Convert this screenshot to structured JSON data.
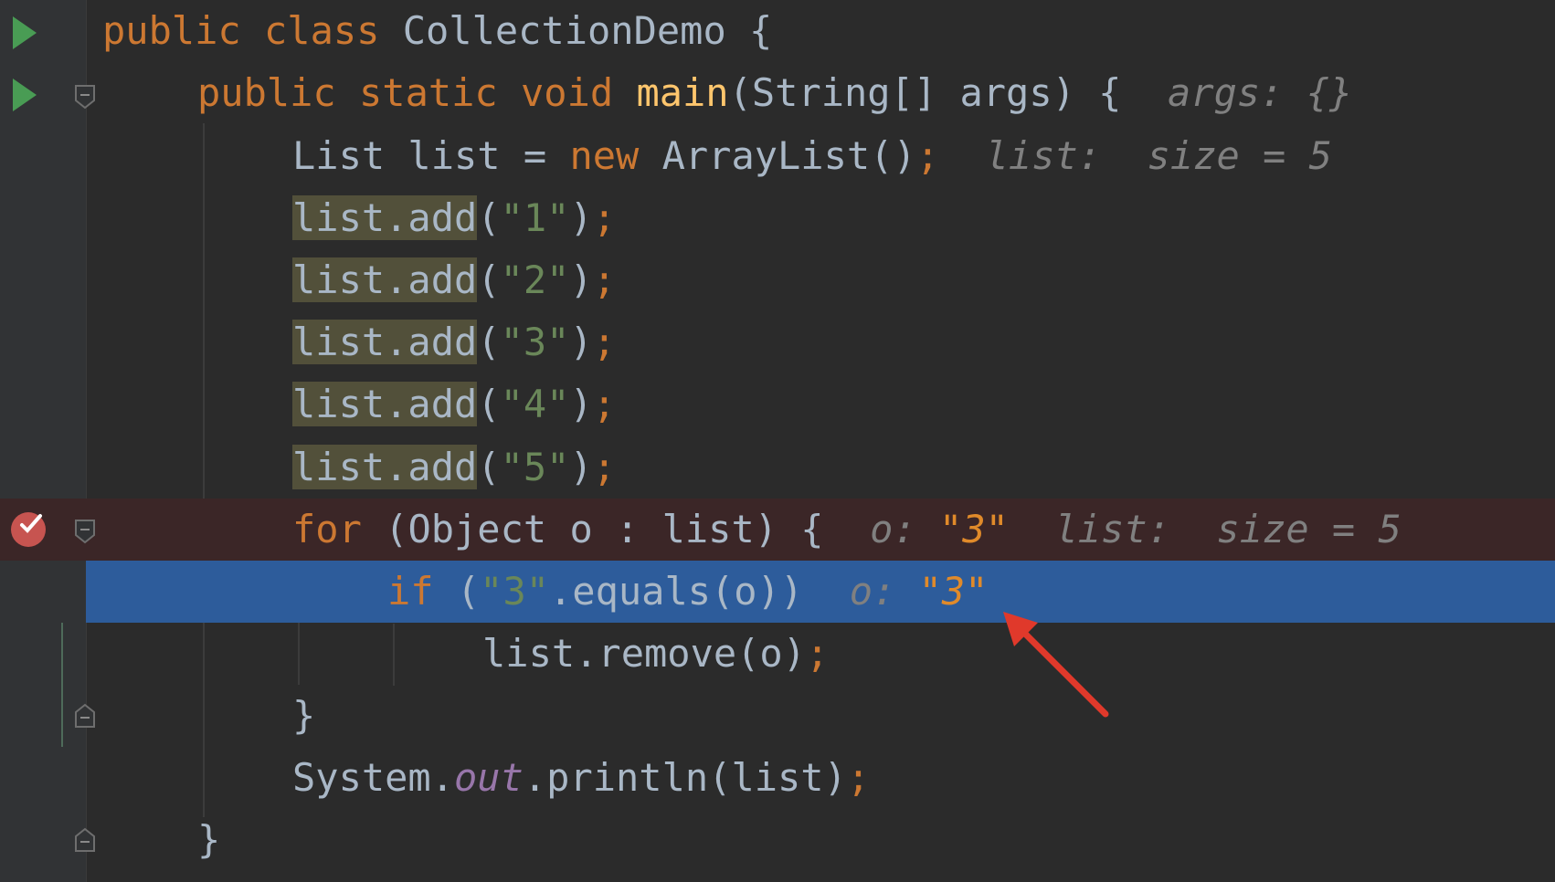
{
  "editor": {
    "lines": [
      {
        "id": "l1",
        "tokens": [
          [
            "kw",
            "public class "
          ],
          [
            "plain",
            "CollectionDemo {"
          ]
        ]
      },
      {
        "id": "l2",
        "tokens": [
          [
            "kw",
            "public static void "
          ],
          [
            "fn",
            "main"
          ],
          [
            "plain",
            "(String[] args) {  "
          ],
          [
            "hint",
            "args: {}"
          ]
        ]
      },
      {
        "id": "l3",
        "tokens": [
          [
            "plain",
            "List list = "
          ],
          [
            "kw",
            "new "
          ],
          [
            "plain",
            "ArrayList()"
          ],
          [
            "semi",
            ";"
          ],
          [
            "plain",
            "  "
          ],
          [
            "hint",
            "list:  size = 5"
          ]
        ]
      },
      {
        "id": "l4",
        "tokens": [
          [
            "hl",
            "list.add"
          ],
          [
            "plain",
            "("
          ],
          [
            "str",
            "\"1\""
          ],
          [
            "plain",
            ")"
          ],
          [
            "semi",
            ";"
          ]
        ]
      },
      {
        "id": "l5",
        "tokens": [
          [
            "hl",
            "list.add"
          ],
          [
            "plain",
            "("
          ],
          [
            "str",
            "\"2\""
          ],
          [
            "plain",
            ")"
          ],
          [
            "semi",
            ";"
          ]
        ]
      },
      {
        "id": "l6",
        "tokens": [
          [
            "hl",
            "list.add"
          ],
          [
            "plain",
            "("
          ],
          [
            "str",
            "\"3\""
          ],
          [
            "plain",
            ")"
          ],
          [
            "semi",
            ";"
          ]
        ]
      },
      {
        "id": "l7",
        "tokens": [
          [
            "hl",
            "list.add"
          ],
          [
            "plain",
            "("
          ],
          [
            "str",
            "\"4\""
          ],
          [
            "plain",
            ")"
          ],
          [
            "semi",
            ";"
          ]
        ]
      },
      {
        "id": "l8",
        "tokens": [
          [
            "hl",
            "list.add"
          ],
          [
            "plain",
            "("
          ],
          [
            "str",
            "\"5\""
          ],
          [
            "plain",
            ")"
          ],
          [
            "semi",
            ";"
          ]
        ]
      },
      {
        "id": "l9",
        "tokens": [
          [
            "kw",
            "for "
          ],
          [
            "plain",
            "(Object o : list) {  "
          ],
          [
            "hint",
            "o: "
          ],
          [
            "hintval",
            "\"3\""
          ],
          [
            "hint",
            "  list:  size = 5"
          ]
        ]
      },
      {
        "id": "l10",
        "tokens": [
          [
            "kw",
            "if "
          ],
          [
            "plain",
            "("
          ],
          [
            "str",
            "\"3\""
          ],
          [
            "plain",
            ".equals(o))  "
          ],
          [
            "hint",
            "o: "
          ],
          [
            "hintval",
            "\"3\""
          ]
        ]
      },
      {
        "id": "l11",
        "tokens": [
          [
            "plain",
            "list.remove(o)"
          ],
          [
            "semi",
            ";"
          ]
        ]
      },
      {
        "id": "l12",
        "tokens": [
          [
            "plain",
            "}"
          ]
        ]
      },
      {
        "id": "l13",
        "tokens": [
          [
            "plain",
            "System."
          ],
          [
            "fld",
            "out"
          ],
          [
            "plain",
            ".println(list)"
          ],
          [
            "semi",
            ";"
          ]
        ]
      },
      {
        "id": "l14",
        "tokens": [
          [
            "plain",
            "}"
          ]
        ]
      }
    ]
  },
  "colors": {
    "background": "#2b2b2b",
    "keyword": "#cc7832",
    "string": "#6a8759",
    "method": "#ffc66d",
    "breakpoint_line": "#3b2627",
    "current_line": "#2d5c9b",
    "hint": "#808080",
    "hint_value": "#e08a2a",
    "arrow": "#e0392b"
  },
  "icons": {
    "run": "run-gutter-icon",
    "breakpoint": "breakpoint-check-icon",
    "fold": "fold-marker-icon",
    "annotation": "red-arrow-annotation"
  }
}
